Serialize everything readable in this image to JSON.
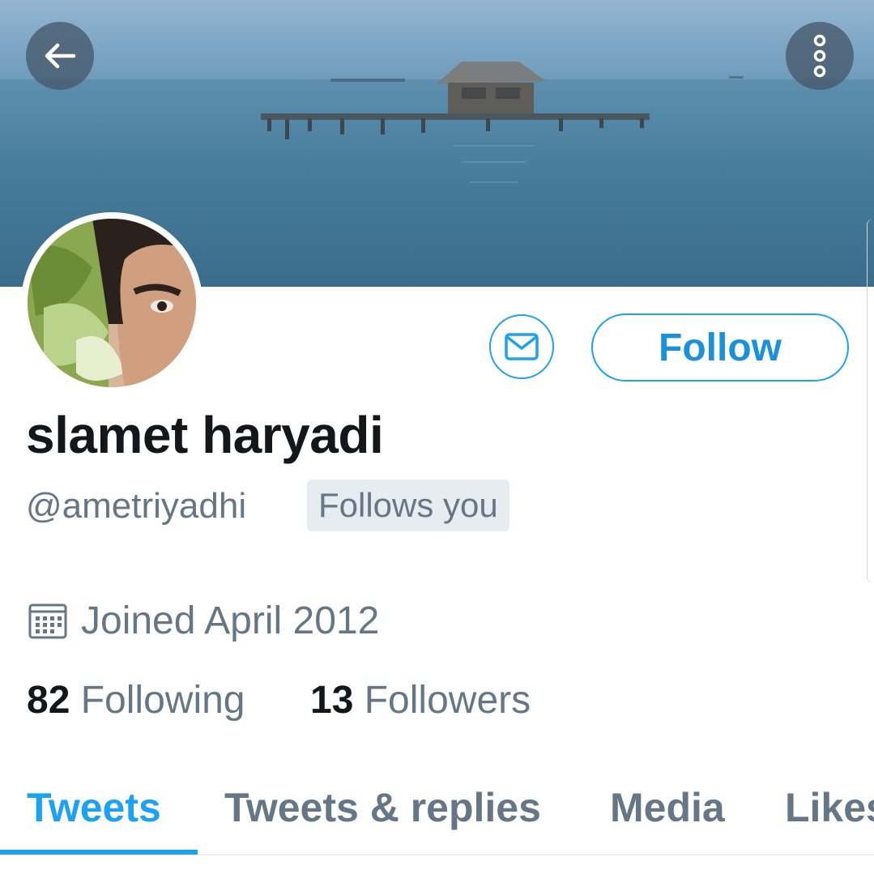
{
  "profile": {
    "display_name": "slamet haryadi",
    "handle": "@ametriyadhi",
    "follows_you_badge": "Follows you",
    "joined": "Joined April 2012",
    "following_count": "82",
    "following_label": "Following",
    "followers_count": "13",
    "followers_label": "Followers"
  },
  "actions": {
    "follow_label": "Follow",
    "back_icon": "arrow-left-icon",
    "more_icon": "more-vertical-icon",
    "message_icon": "envelope-icon"
  },
  "tabs": [
    {
      "label": "Tweets",
      "active": true
    },
    {
      "label": "Tweets & replies",
      "active": false
    },
    {
      "label": "Media",
      "active": false
    },
    {
      "label": "Likes",
      "active": false
    }
  ],
  "colors": {
    "accent": "#1da1f2",
    "text_primary": "#14171a",
    "text_secondary": "#657786",
    "badge_bg": "#e6ecf0"
  }
}
